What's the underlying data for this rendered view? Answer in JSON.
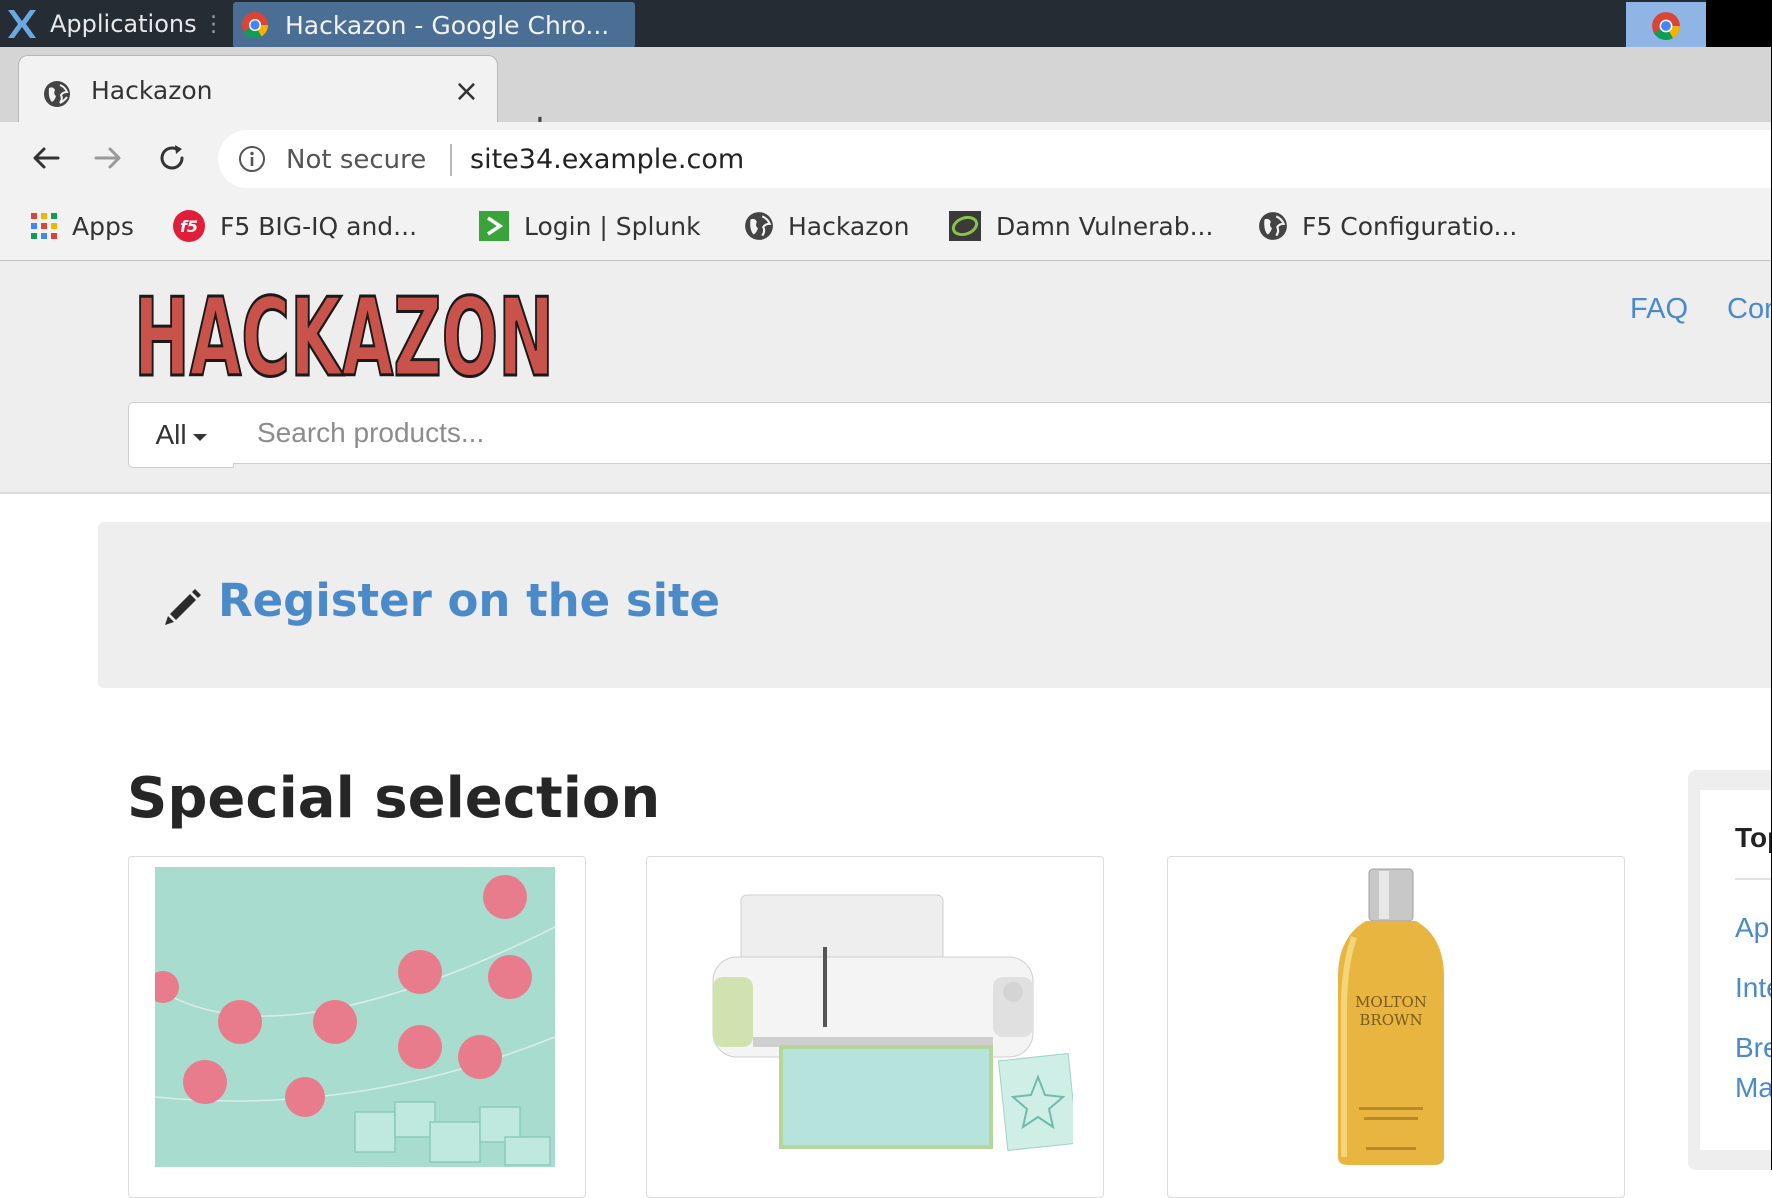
{
  "desktop": {
    "apps_menu_label": "Applications",
    "task_title": "Hackazon - Google Chro..."
  },
  "browser": {
    "tab_title": "Hackazon",
    "tab_close": "×",
    "new_tab": "+",
    "security_label": "Not secure",
    "url": "site34.example.com",
    "bookmarks": [
      {
        "label": "Apps",
        "icon": "apps-grid-icon"
      },
      {
        "label": "F5 BIG-IQ and...",
        "icon": "f5-icon"
      },
      {
        "label": "Login | Splunk",
        "icon": "splunk-icon"
      },
      {
        "label": "Hackazon",
        "icon": "globe-icon"
      },
      {
        "label": "Damn Vulnerab...",
        "icon": "dvwa-icon"
      },
      {
        "label": "F5 Configuratio...",
        "icon": "globe-icon"
      }
    ]
  },
  "site": {
    "logo_text": "HACKAZON",
    "nav": {
      "faq": "FAQ",
      "contact": "Con"
    },
    "search": {
      "category": "All",
      "placeholder": "Search products..."
    },
    "register_label": "Register on the site",
    "section_title": "Special selection",
    "products": [
      {
        "image": "pink pom-pom garland with gift boxes"
      },
      {
        "image": "cutting machine with card"
      },
      {
        "image": "Molton Brown shampoo bottle",
        "brand_text": "MOLTON BROWN"
      }
    ],
    "sidebar": {
      "title": "Top",
      "links": [
        "App",
        "Inte",
        "Bre",
        "Ma"
      ]
    }
  },
  "colors": {
    "link": "#4a8ac8",
    "logo_red": "#c9524a",
    "panel": "#262c34",
    "task_highlight": "#4a6e94"
  }
}
